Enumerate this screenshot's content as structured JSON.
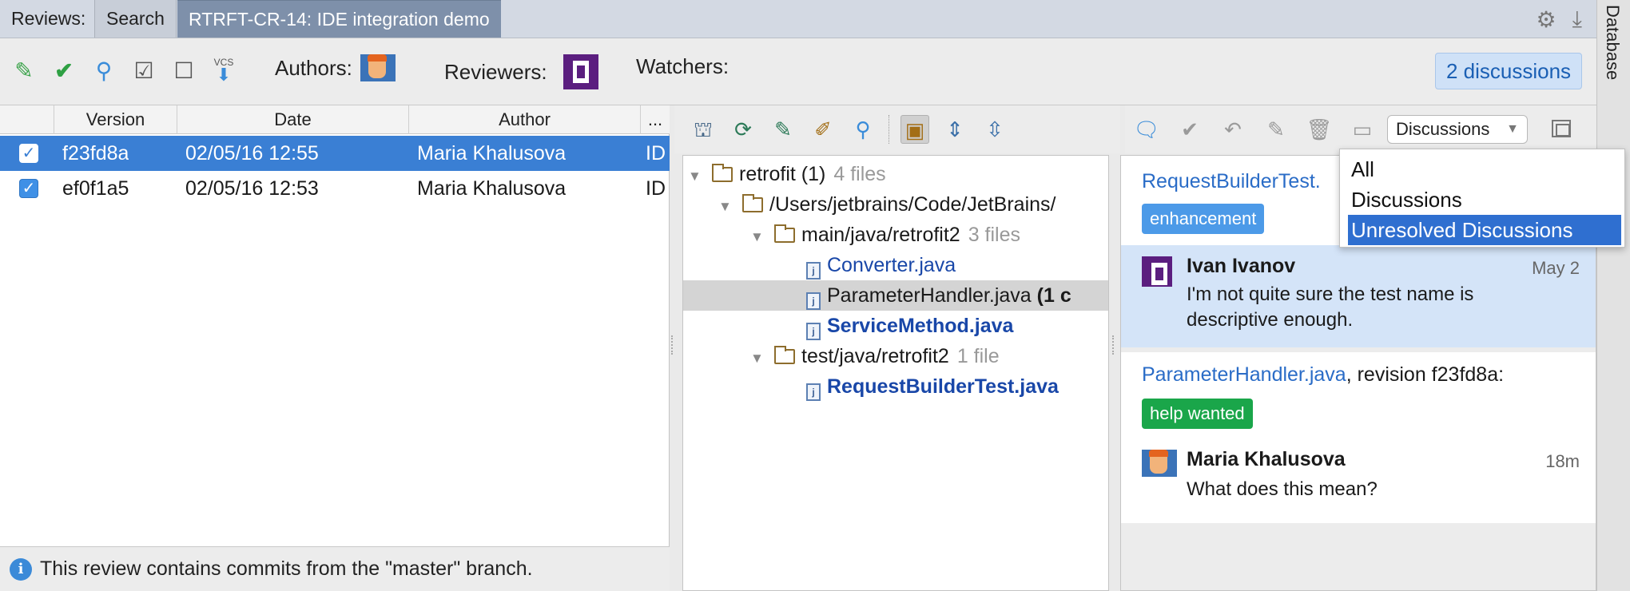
{
  "tabs": {
    "reviews_label": "Reviews:",
    "search": "Search",
    "active": "RTRFT-CR-14: IDE integration demo"
  },
  "top_right": {
    "settings_icon": "gear-icon",
    "download_icon": "download-icon"
  },
  "side_strip": {
    "label": "Database"
  },
  "toolbar": {
    "icons": [
      "pencil-icon",
      "checkmark-icon",
      "review-search-icon",
      "checkbox-checked-icon",
      "checkbox-empty-icon",
      "vcs-update-icon"
    ],
    "vcs_label": "VCS",
    "authors_label": "Authors:",
    "reviewers_label": "Reviewers:",
    "watchers_label": "Watchers:",
    "discussions_button": "2 discussions"
  },
  "commits": {
    "columns": [
      "Version",
      "Date",
      "Author",
      "..."
    ],
    "rows": [
      {
        "version": "f23fd8a",
        "date": "02/05/16 12:55",
        "author": "Maria Khalusova",
        "extra": "ID",
        "checked": true,
        "selected": true
      },
      {
        "version": "ef0f1a5",
        "date": "02/05/16 12:53",
        "author": "Maria Khalusova",
        "extra": "ID",
        "checked": true,
        "selected": false
      }
    ],
    "notice": "This review contains commits from the \"master\" branch."
  },
  "tree": {
    "root": {
      "name": "retrofit (1)",
      "count": "4 files"
    },
    "path": "/Users/jetbrains/Code/JetBrains/",
    "folder1": {
      "name": "main/java/retrofit2",
      "count": "3 files"
    },
    "files1": [
      {
        "name": "Converter.java"
      },
      {
        "name": "ParameterHandler.java",
        "suffix": "(1 c"
      },
      {
        "name": "ServiceMethod.java"
      }
    ],
    "folder2": {
      "name": "test/java/retrofit2",
      "count": "1 file"
    },
    "files2": [
      {
        "name": "RequestBuilderTest.java"
      }
    ]
  },
  "discussions": {
    "dropdown_value": "Discussions",
    "menu": [
      "All",
      "Discussions",
      "Unresolved Discussions"
    ],
    "items": [
      {
        "file": "RequestBuilderTest.",
        "tag": "enhancement",
        "author": "Ivan Ivanov",
        "time": "May 2",
        "text": "I'm not quite sure the test name is descriptive enough."
      },
      {
        "file": "ParameterHandler.java",
        "revision": ", revision f23fd8a:",
        "tag": "help wanted",
        "author": "Maria Khalusova",
        "time": "18m",
        "text": "What does this mean?"
      }
    ]
  },
  "colors": {
    "selection": "#3a7fd4",
    "link": "#1947a8",
    "tag_enhancement": "#4c9ae8",
    "tag_help": "#1aa64a",
    "highlight": "#d4e4f8"
  }
}
